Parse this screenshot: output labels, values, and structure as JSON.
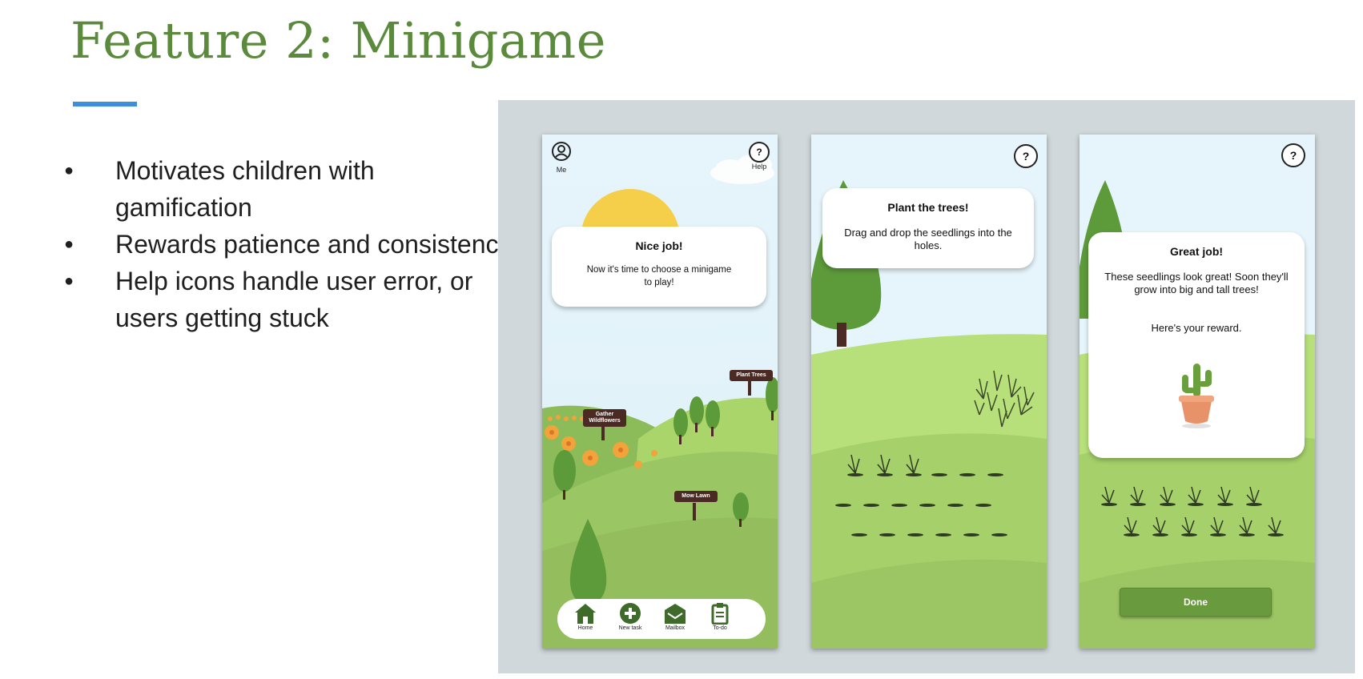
{
  "slide": {
    "title": "Feature 2: Minigame",
    "bullets": [
      "Motivates children with gamification",
      "Rewards patience and consistency",
      "Help icons handle user error, or users getting stuck"
    ]
  },
  "screens": {
    "home": {
      "me_label": "Me",
      "help_label": "Help",
      "help_glyph": "?",
      "card_title": "Nice job!",
      "card_text": "Now it's time to choose a minigame to play!",
      "signs": {
        "plant_trees": "Plant Trees",
        "gather_wildflowers": "Gather Wildflowers",
        "mow_lawn": "Mow Lawn"
      },
      "nav": [
        {
          "label": "Home",
          "icon": "home-icon"
        },
        {
          "label": "New task",
          "icon": "plus-circle-icon"
        },
        {
          "label": "Mailbox",
          "icon": "mail-icon"
        },
        {
          "label": "To-do",
          "icon": "clipboard-icon"
        }
      ]
    },
    "plant": {
      "help_glyph": "?",
      "card_title": "Plant the trees!",
      "card_text": "Drag and drop the seedlings into the holes."
    },
    "reward": {
      "help_glyph": "?",
      "card_title": "Great job!",
      "card_text": "These seedlings look great! Soon they'll grow into big and tall trees!",
      "reward_text": "Here's your reward.",
      "done_label": "Done"
    }
  },
  "colors": {
    "title": "#5b8a3c",
    "accent_rule": "#3d8fde",
    "stage_bg": "#d0d8db",
    "grass": "#a6d36a",
    "sign": "#4a2a22",
    "button": "#6a9a3e"
  }
}
